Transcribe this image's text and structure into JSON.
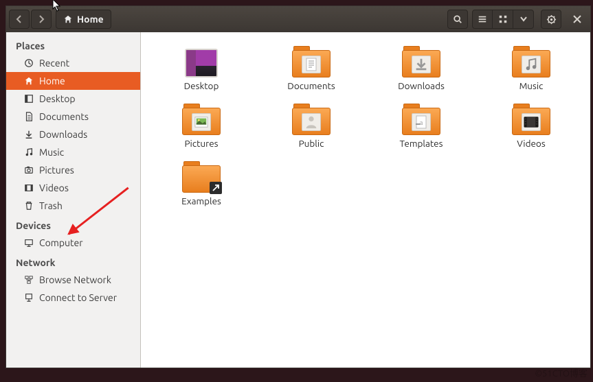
{
  "path": {
    "current": "Home"
  },
  "sidebar": {
    "sections": [
      {
        "title": "Places",
        "items": [
          {
            "id": "recent",
            "label": "Recent",
            "icon": "clock",
            "selected": false
          },
          {
            "id": "home",
            "label": "Home",
            "icon": "home",
            "selected": true
          },
          {
            "id": "desktop",
            "label": "Desktop",
            "icon": "desktop",
            "selected": false
          },
          {
            "id": "documents",
            "label": "Documents",
            "icon": "document",
            "selected": false
          },
          {
            "id": "downloads",
            "label": "Downloads",
            "icon": "download",
            "selected": false
          },
          {
            "id": "music",
            "label": "Music",
            "icon": "music",
            "selected": false
          },
          {
            "id": "pictures",
            "label": "Pictures",
            "icon": "camera",
            "selected": false
          },
          {
            "id": "videos",
            "label": "Videos",
            "icon": "video",
            "selected": false
          },
          {
            "id": "trash",
            "label": "Trash",
            "icon": "trash",
            "selected": false
          }
        ]
      },
      {
        "title": "Devices",
        "items": [
          {
            "id": "computer",
            "label": "Computer",
            "icon": "computer",
            "selected": false
          }
        ]
      },
      {
        "title": "Network",
        "items": [
          {
            "id": "browse-network",
            "label": "Browse Network",
            "icon": "network",
            "selected": false
          },
          {
            "id": "connect-server",
            "label": "Connect to Server",
            "icon": "server",
            "selected": false
          }
        ]
      }
    ]
  },
  "files": [
    {
      "id": "desktop",
      "label": "Desktop",
      "kind": "desktop"
    },
    {
      "id": "documents",
      "label": "Documents",
      "kind": "folder",
      "emblem": "document"
    },
    {
      "id": "downloads",
      "label": "Downloads",
      "kind": "folder",
      "emblem": "download"
    },
    {
      "id": "music",
      "label": "Music",
      "kind": "folder",
      "emblem": "music"
    },
    {
      "id": "pictures",
      "label": "Pictures",
      "kind": "folder",
      "emblem": "picture"
    },
    {
      "id": "public",
      "label": "Public",
      "kind": "folder",
      "emblem": "public"
    },
    {
      "id": "templates",
      "label": "Templates",
      "kind": "folder",
      "emblem": "template"
    },
    {
      "id": "videos",
      "label": "Videos",
      "kind": "folder",
      "emblem": "video"
    },
    {
      "id": "examples",
      "label": "Examples",
      "kind": "folder-link",
      "emblem": ""
    }
  ],
  "watermark": "©51CTO博客"
}
